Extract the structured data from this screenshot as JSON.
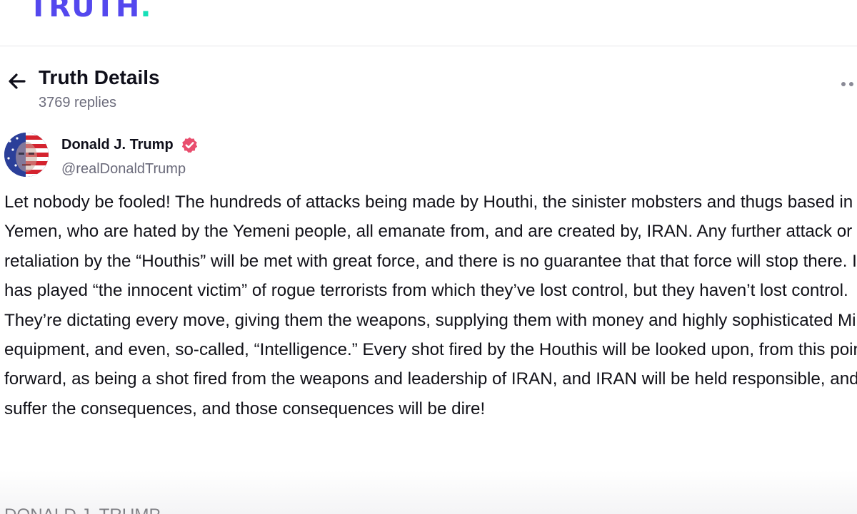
{
  "brand": {
    "logo_text": "TRUTH",
    "logo_dot": ".",
    "accent": "#5448ee",
    "dot_color": "#17e0b8"
  },
  "header": {
    "back_icon": "arrow-left-icon",
    "title": "Truth Details",
    "subtitle": "3769 replies",
    "more_icon": "more-horizontal-icon"
  },
  "author": {
    "name": "Donald J. Trump",
    "handle": "@realDonaldTrump",
    "verified_icon": "verified-badge-icon",
    "verified_color": "#e94e6e"
  },
  "post": {
    "text": "Let nobody be fooled! The hundreds of attacks being made by Houthi, the sinister mobsters and thugs based in Yemen, who are hated by the Yemeni people, all emanate from, and are created by, IRAN. Any further attack or retaliation by the “Houthis” will be met with great force, and there is no guarantee that that force will stop there. Iran has played “the innocent victim” of rogue terrorists from which they’ve lost control, but they haven’t lost control. They’re dictating every move, giving them the weapons, supplying them with money and highly sophisticated Military equipment, and even, so-called, “Intelligence.” Every shot fired by the Houthis will be looked upon, from this point forward, as being a shot fired from the weapons and leadership of IRAN, and IRAN will be held responsible, and suffer the consequences, and those consequences will be dire!",
    "signature": "DONALD J. TRUMP"
  }
}
